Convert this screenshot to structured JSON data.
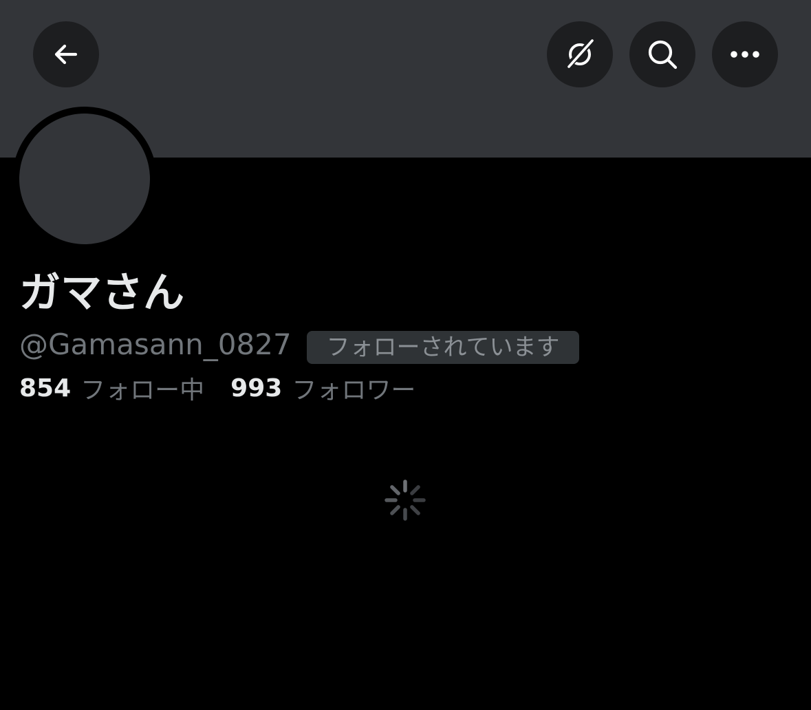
{
  "header": {
    "back_icon": "arrow-left-icon",
    "grok_icon": "grok-icon",
    "search_icon": "search-icon",
    "more_icon": "more-horizontal-icon"
  },
  "profile": {
    "display_name": "ガマさん",
    "handle": "@Gamasann_0827",
    "follows_you_badge": "フォローされています",
    "following_count": "854",
    "following_label": "フォロー中",
    "followers_count": "993",
    "followers_label": "フォロワー"
  },
  "status": {
    "loading_icon": "loading-spinner-icon"
  },
  "colors": {
    "background": "#000000",
    "banner": "#333539",
    "button_bg": "#1d1e20",
    "primary_text": "#e7e9ea",
    "secondary_text": "#71767b",
    "badge_bg": "#2f3336"
  }
}
